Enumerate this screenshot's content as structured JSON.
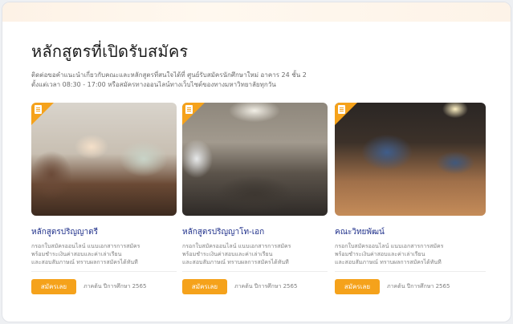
{
  "section": {
    "title": "หลักสูตรที่เปิดรับสมัคร",
    "description_line1": "ติดต่อขอคำแนะนำเกี่ยวกับคณะและหลักสูตรที่สนใจได้ที่ ศูนย์รับสมัครนักศึกษาใหม่ อาคาร 24 ชั้น 2",
    "description_line2": "ตั้งแต่เวลา 08:30 - 17:00 หรือสมัครทางออนไลน์ทางเว็บไซต์ของทางมหาวิทยาลัยทุกวัน"
  },
  "colors": {
    "accent": "#f5a21b",
    "title_blue": "#1e2f8a",
    "top_band": "#fdf2e6"
  },
  "cards": [
    {
      "title": "หลักสูตรปริญญาตรี",
      "text_line1": "กรอกใบสมัครออนไลน์ แนบเอกสารการสมัคร",
      "text_line2": "พร้อมชำระเงินค่าสอบและค่าเล่าเรียน",
      "text_line3": "และสอบสัมภาษณ์ ทราบผลการสมัครได้ทันที",
      "button": "สมัครเลย",
      "term": "ภาคต้น ปีการศึกษา 2565",
      "badge_icon": "document-icon"
    },
    {
      "title": "หลักสูตรปริญญาโท-เอก",
      "text_line1": "กรอกใบสมัครออนไลน์ แนบเอกสารการสมัคร",
      "text_line2": "พร้อมชำระเงินค่าสอบและค่าเล่าเรียน",
      "text_line3": "และสอบสัมภาษณ์ ทราบผลการสมัครได้ทันที",
      "button": "สมัครเลย",
      "term": "ภาคต้น ปีการศึกษา 2565",
      "badge_icon": "document-icon"
    },
    {
      "title": "คณะวิทยพัฒน์",
      "text_line1": "กรอกใบสมัครออนไลน์ แนบเอกสารการสมัคร",
      "text_line2": "พร้อมชำระเงินค่าสอบและค่าเล่าเรียน",
      "text_line3": "และสอบสัมภาษณ์ ทราบผลการสมัครได้ทันที",
      "button": "สมัครเลย",
      "term": "ภาคต้น ปีการศึกษา 2565",
      "badge_icon": "document-icon"
    }
  ]
}
